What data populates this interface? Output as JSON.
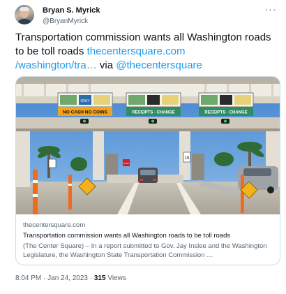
{
  "author": {
    "display_name": "Bryan S. Myrick",
    "handle": "@BryanMyrick"
  },
  "tweet": {
    "text_main": "Transportation commission wants all Washington roads to be toll roads ",
    "link_text": "thecentersquare.com\n/washington/tra…",
    "via_text": " via ",
    "mention": "@thecentersquare"
  },
  "card": {
    "domain": "thecentersquare.com",
    "title": "Transportation commission wants all Washington roads to be toll roads",
    "description": "(The Center Square) – In a report submitted to Gov. Jay Inslee and the Washington Legislature, the Washington State Transportation Commission …",
    "image_signs": {
      "left_top": "ONLY",
      "left_bottom": "NO CASH NO COINS",
      "center_bottom": "RECEIPTS · CHANGE",
      "right_bottom": "RECEIPTS · CHANGE",
      "lane_stop": "STOP",
      "lane_15": "15"
    },
    "image_colors": {
      "sky": "#4f8ed4",
      "canopy": "#e9e4da",
      "sign_green": "#2f8f63",
      "sign_orange": "#f3a21b"
    }
  },
  "meta": {
    "time": "8:04 PM",
    "separator": " · ",
    "date": "Jan 24, 2023",
    "views_count": "315",
    "views_label": " Views"
  },
  "icons": {
    "more": "more-options-icon"
  }
}
